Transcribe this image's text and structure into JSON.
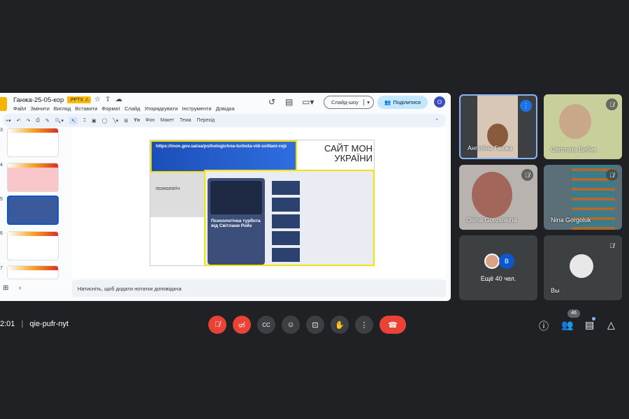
{
  "slides_app": {
    "doc_title": "Ганжа-25-05-кор",
    "badge": ".PPTX ⚠",
    "menu": [
      "Файл",
      "Змінити",
      "Вигляд",
      "Вставити",
      "Формат",
      "Слайд",
      "Упорядкувати",
      "Інструменти",
      "Довідка"
    ],
    "slideshow_label": "Слайд-шоу",
    "share_label": "Поділитися",
    "account_initial": "О",
    "toolbar": [
      "Фон",
      "Макет",
      "Тема",
      "Перехід"
    ],
    "font_button": "Yн",
    "thumb_numbers": [
      "3",
      "4",
      "5",
      "6",
      "7"
    ],
    "selected_slide": "5",
    "notes_placeholder": "Натисніть, щоб додати нотатки доповідача",
    "slide": {
      "url": "https://mon.gov.ua/ua/psihologichna-turbota-vid-svitlani-rojz",
      "heading_line1": "САЙТ МОН",
      "heading_line2": "УКРАЇНИ",
      "page_heading": "психологіч",
      "playlist_title": "Психологічна турбота від Світлани Ройз"
    }
  },
  "participants": [
    {
      "name": "Ангеліна Ганжа",
      "speaking": true
    },
    {
      "name": "Світлана Вибик",
      "muted": true
    },
    {
      "name": "Olena Goroshkina",
      "muted": true
    },
    {
      "name": "Nina Gorgoluk",
      "muted": true
    }
  ],
  "more_tile": {
    "label": "Ещё 40 чел.",
    "avatar_initial": "B"
  },
  "self_tile": {
    "label": "Вы",
    "muted": true
  },
  "meeting": {
    "time": "2:01",
    "code": "qie-pufr-nyt",
    "participant_count": "46"
  },
  "colors": {
    "background": "#202124",
    "end_call": "#ea4335",
    "accent": "#8ab4f8"
  }
}
